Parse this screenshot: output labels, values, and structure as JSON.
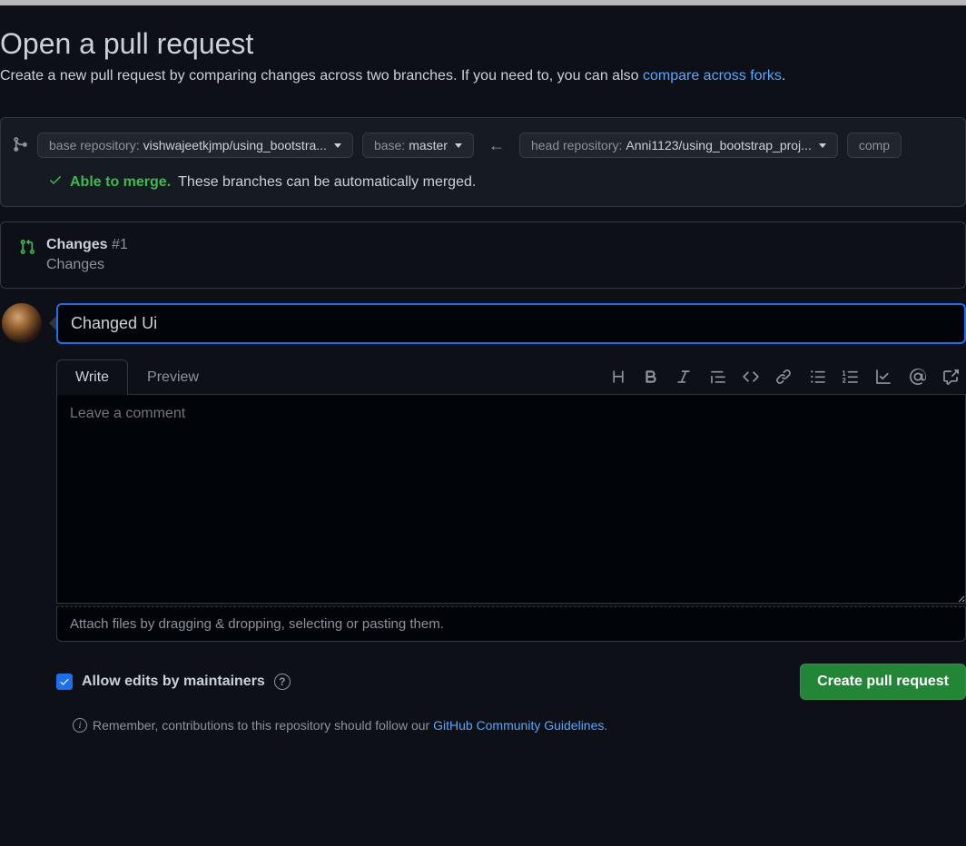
{
  "header": {
    "title": "Open a pull request",
    "subtitle_pre": "Create a new pull request by comparing changes across two branches. If you need to, you can also ",
    "compare_link": "compare across forks",
    "subtitle_post": "."
  },
  "branch": {
    "base_repo_label": "base repository: ",
    "base_repo_value": "vishwajeetkjmp/using_bootstra...",
    "base_label": "base: ",
    "base_value": "master",
    "head_repo_label": "head repository: ",
    "head_repo_value": "Anni1123/using_bootstrap_proj...",
    "compare_label": "comp"
  },
  "merge": {
    "able_text": "Able to merge.",
    "detail": "These branches can be automatically merged."
  },
  "existing_pr": {
    "title": "Changes",
    "number": "#1",
    "subtitle": "Changes"
  },
  "form": {
    "title_value": "Changed Ui",
    "tabs": {
      "write": "Write",
      "preview": "Preview"
    },
    "comment_placeholder": "Leave a comment",
    "attach_hint": "Attach files by dragging & dropping, selecting or pasting them.",
    "allow_edits": "Allow edits by maintainers",
    "create_button": "Create pull request"
  },
  "guidelines": {
    "pre": "Remember, contributions to this repository should follow our ",
    "link": "GitHub Community Guidelines",
    "post": "."
  }
}
